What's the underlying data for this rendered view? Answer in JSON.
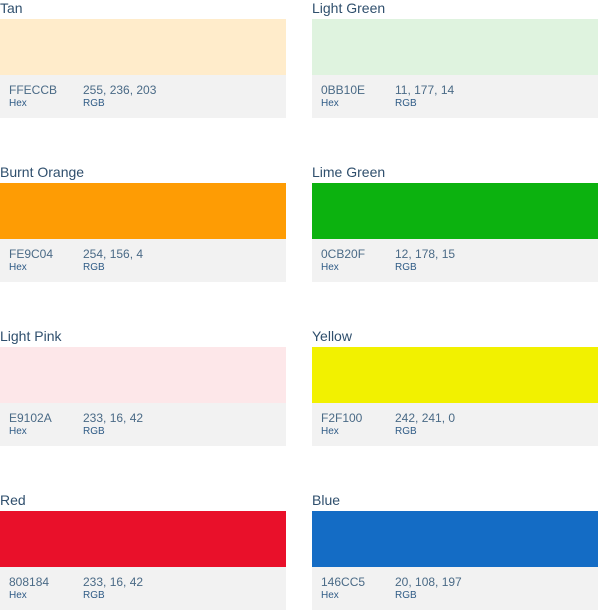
{
  "labels": {
    "hex": "Hex",
    "rgb": "RGB"
  },
  "swatches": [
    {
      "name": "Tan",
      "hex": "FFECCB",
      "rgb": "255, 236, 203",
      "color": "#FFECCB"
    },
    {
      "name": "Light Green",
      "hex": "0BB10E",
      "rgb": "11, 177, 14",
      "color": "#DFF3DF"
    },
    {
      "name": "Burnt Orange",
      "hex": "FE9C04",
      "rgb": "254, 156, 4",
      "color": "#FE9C04"
    },
    {
      "name": "Lime Green",
      "hex": "0CB20F",
      "rgb": "12, 178, 15",
      "color": "#0CB20F"
    },
    {
      "name": "Light Pink",
      "hex": "E9102A",
      "rgb": "233, 16, 42",
      "color": "#FDE7E9"
    },
    {
      "name": "Yellow",
      "hex": "F2F100",
      "rgb": "242, 241, 0",
      "color": "#F2F100"
    },
    {
      "name": "Red",
      "hex": "808184",
      "rgb": "233, 16, 42",
      "color": "#E9102A"
    },
    {
      "name": "Blue",
      "hex": "146CC5",
      "rgb": "20, 108, 197",
      "color": "#146CC5"
    }
  ]
}
